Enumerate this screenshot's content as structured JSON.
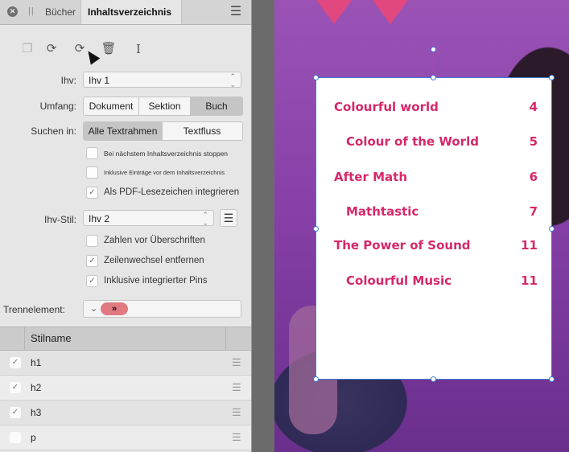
{
  "panel": {
    "tabs": [
      "Bücher",
      "Inhaltsverzeichnis"
    ],
    "ihv_label": "Ihv:",
    "ihv_value": "Ihv 1",
    "umfang_label": "Umfang:",
    "umfang_options": [
      "Dokument",
      "Sektion",
      "Buch"
    ],
    "umfang_selected": "Buch",
    "suchen_label": "Suchen in:",
    "suchen_options": [
      "Alle Textrahmen",
      "Textfluss"
    ],
    "suchen_selected": "Alle Textrahmen",
    "options1": [
      {
        "label": "Bei nächstem Inhaltsverzeichnis stoppen",
        "checked": false
      },
      {
        "label": "Inklusive Einträge vor dem Inhaltsverzeichnis",
        "checked": false
      },
      {
        "label": "Als PDF-Lesezeichen integrieren",
        "checked": true
      }
    ],
    "stil_label": "Ihv-Stil:",
    "stil_value": "Ihv 2",
    "options2": [
      {
        "label": "Zahlen vor Überschriften",
        "checked": false
      },
      {
        "label": "Zeilenwechsel entfernen",
        "checked": true
      },
      {
        "label": "Inklusive integrierter Pins",
        "checked": true
      }
    ],
    "trennelement_label": "Trennelement:",
    "trennelement_glyph": "»",
    "list_header": "Stilname",
    "styles": [
      {
        "name": "h1",
        "checked": true
      },
      {
        "name": "h2",
        "checked": true
      },
      {
        "name": "h3",
        "checked": true
      },
      {
        "name": "p",
        "checked": false
      }
    ]
  },
  "toc": {
    "entries": [
      {
        "title": "Colourful world",
        "page": "4",
        "level": 1
      },
      {
        "title": "Colour of the World",
        "page": "5",
        "level": 2
      },
      {
        "title": "After Math",
        "page": "6",
        "level": 1
      },
      {
        "title": "Mathtastic",
        "page": "7",
        "level": 2
      },
      {
        "title": "The Power of Sound",
        "page": "11",
        "level": 1
      },
      {
        "title": "Colourful Music",
        "page": "11",
        "level": 2
      }
    ]
  },
  "colors": {
    "toc_text": "#d6286a",
    "selection": "#3d7ad6",
    "separator_pill": "#e07a80"
  },
  "icons": {
    "tab_close": "close-icon",
    "panel_menu": "hamburger-icon",
    "tools": [
      "copy-icon",
      "refresh-icon",
      "refresh-all-icon",
      "trash-icon",
      "text-cursor-icon"
    ]
  }
}
